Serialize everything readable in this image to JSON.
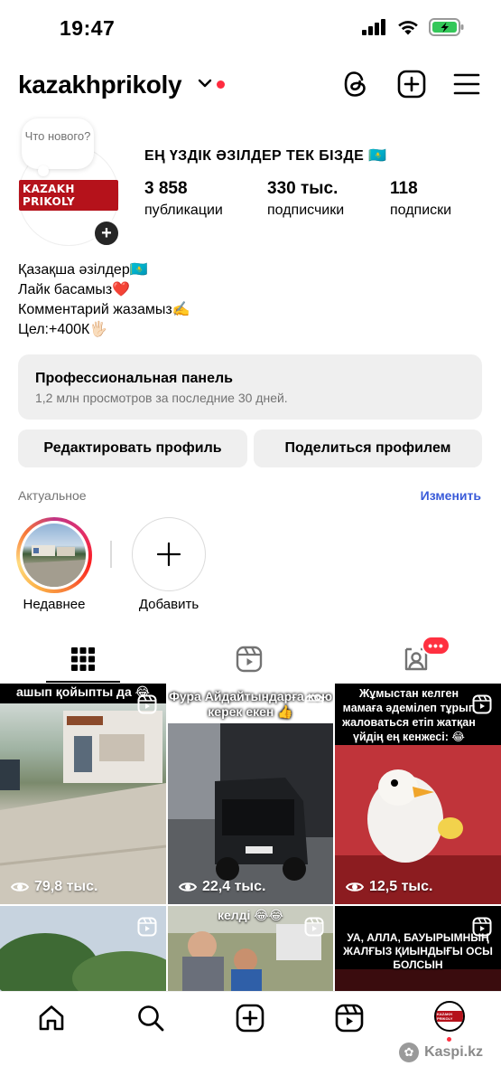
{
  "status_bar": {
    "time": "19:47"
  },
  "header": {
    "username": "kazakhprikoly"
  },
  "profile": {
    "note": "Что нового?",
    "avatar_logo_text": "KAZAKH PRIKOLY",
    "name": "ЕҢ ҮЗДІК ӘЗІЛДЕР ТЕК БІЗДЕ 🇰🇿",
    "stats": [
      {
        "value": "3 858",
        "label": "публикации"
      },
      {
        "value": "330 тыс.",
        "label": "подписчики"
      },
      {
        "value": "118",
        "label": "подписки"
      }
    ],
    "bio": [
      "Қазақша әзілдер🇰🇿",
      "Лайк басамыз❤️",
      "Комментарий жазамыз✍️",
      "Цел:+400К🖐🏻"
    ]
  },
  "pro_panel": {
    "title": "Профессиональная панель",
    "subtitle": "1,2 млн просмотров за последние 30 дней."
  },
  "buttons": {
    "edit_profile": "Редактировать профиль",
    "share_profile": "Поделиться профилем"
  },
  "highlights": {
    "section_label": "Актуальное",
    "edit_label": "Изменить",
    "items": [
      {
        "label": "Недавнее"
      },
      {
        "label": "Добавить"
      }
    ]
  },
  "tabs": {
    "tagged_badge": "•••"
  },
  "grid": [
    {
      "caption": "ашып қойыпты да 😂",
      "views": "79,8 тыс."
    },
    {
      "caption": "Фура Айдайтындарға кою керек екен 👍",
      "views": "22,4 тыс."
    },
    {
      "caption": "Жұмыстан келген мамаға әдемілеп тұрып жаловаться етіп жатқан үйдің ең кенжесі: 😂",
      "views": "12,5 тыс."
    },
    {
      "caption": "",
      "views": ""
    },
    {
      "caption": "келді 😂😂",
      "views": ""
    },
    {
      "caption": "УА, АЛЛА, БАУЫРЫМНЫҢ ЖАЛҒЫЗ ҚИЫНДЫҒЫ ОСЫ БОЛСЫН",
      "views": ""
    }
  ],
  "watermark": "Kaspi.kz",
  "colors": {
    "accent": "#3a5bd9",
    "notification": "#ff3040",
    "panel_bg": "#efefef"
  }
}
